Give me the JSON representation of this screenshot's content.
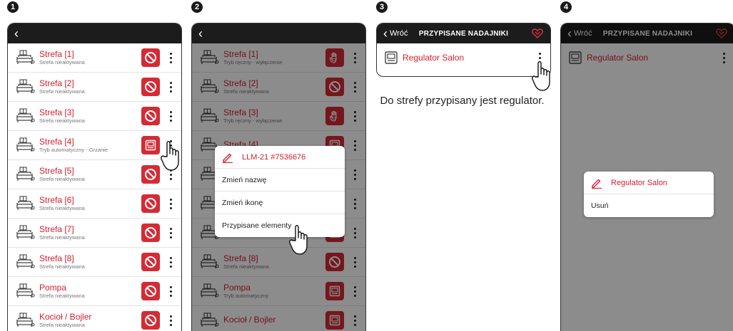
{
  "steps": [
    "1",
    "2",
    "3",
    "4"
  ],
  "panel1": {
    "rows": [
      {
        "name": "Strefa [1]",
        "sub": "Strefa nieaktywana",
        "badge": "off"
      },
      {
        "name": "Strefa [2]",
        "sub": "Strefa nieaktywana",
        "badge": "off"
      },
      {
        "name": "Strefa [3]",
        "sub": "Strefa nieaktywana",
        "badge": "off"
      },
      {
        "name": "Strefa [4]",
        "sub": "Tryb automatyczny - Grzanie",
        "badge": "regulator"
      },
      {
        "name": "Strefa [5]",
        "sub": "Strefa nieaktywana",
        "badge": "off"
      },
      {
        "name": "Strefa [6]",
        "sub": "Strefa nieaktywana",
        "badge": "off"
      },
      {
        "name": "Strefa [7]",
        "sub": "Strefa nieaktywana",
        "badge": "off"
      },
      {
        "name": "Strefa [8]",
        "sub": "Strefa nieaktywana",
        "badge": "off"
      },
      {
        "name": "Pompa",
        "sub": "Strefa nieaktywana",
        "badge": "off"
      },
      {
        "name": "Kocioł / Bojler",
        "sub": "Strefa nieaktywana",
        "badge": "off"
      }
    ]
  },
  "panel2": {
    "rows": [
      {
        "name": "Strefa [1]",
        "sub": "Tryb ręczny - wyłączenie",
        "badge": "hand"
      },
      {
        "name": "Strefa [2]",
        "sub": "Strefa nieaktywana",
        "badge": "off"
      },
      {
        "name": "Strefa [3]",
        "sub": "Tryb ręczny - wyłączenie",
        "badge": "hand"
      },
      {
        "name": "Strefa [4]",
        "sub": "",
        "badge": "regulator"
      },
      {
        "name": "",
        "sub": "",
        "badge": "regulator"
      },
      {
        "name": "",
        "sub": "",
        "badge": "regulator"
      },
      {
        "name": "",
        "sub": "",
        "badge": "regulator"
      },
      {
        "name": "Strefa [8]",
        "sub": "Strefa nieaktywana",
        "badge": "off"
      },
      {
        "name": "Pompa",
        "sub": "Tryb automatyczny",
        "badge": "regulator"
      },
      {
        "name": "Kocioł / Bojler",
        "sub": "",
        "badge": "regulator"
      }
    ],
    "menu": {
      "title": "LLM-21 #7536676",
      "items": [
        "Zmień nazwę",
        "Zmień ikonę",
        "Przypisane elementy"
      ]
    }
  },
  "panel3": {
    "back_label": "Wróć",
    "title": "PRZYPISANE NADAJNIKI",
    "item": "Regulator Salon"
  },
  "caption": "Do strefy przypisany jest regulator.",
  "panel4": {
    "back_label": "Wróć",
    "title": "PRZYPISANE NADAJNIKI",
    "item": "Regulator Salon",
    "menu": {
      "title": "Regulator Salon",
      "items": [
        "Usuń"
      ]
    }
  },
  "colors": {
    "accent": "#d32030",
    "badge": "#d42b35",
    "bar": "#1c1c1c"
  }
}
